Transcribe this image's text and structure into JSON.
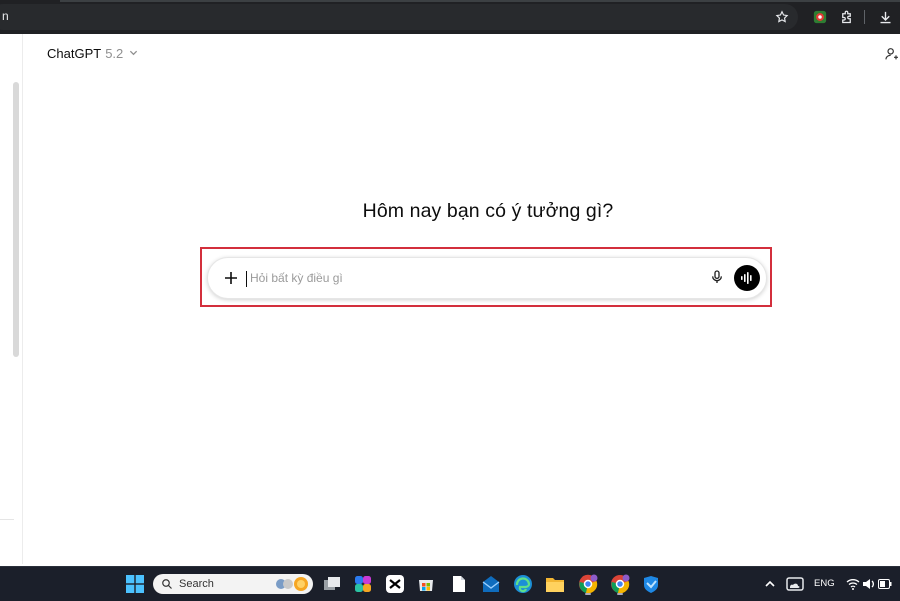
{
  "browser": {
    "address_fragment": "n"
  },
  "header": {
    "model_name": "ChatGPT",
    "model_version": "5.2",
    "chevron_icon": "chevron-down-icon",
    "share_icon": "add-person-icon"
  },
  "main": {
    "headline": "Hôm nay bạn có ý tưởng gì?"
  },
  "composer": {
    "placeholder": "Hỏi bất kỳ điều gì",
    "value": "",
    "highlight_color": "#d32f3c",
    "icons": {
      "attach": "plus-icon",
      "dictate": "microphone-icon",
      "voice_mode": "voice-waveform-icon"
    }
  },
  "taskbar": {
    "search_label": "Search",
    "language": "ENG"
  },
  "colors": {
    "chrome_bg": "#202124",
    "taskbar_bg": "#1b1f2a",
    "accent_highlight": "#d32f3c"
  }
}
